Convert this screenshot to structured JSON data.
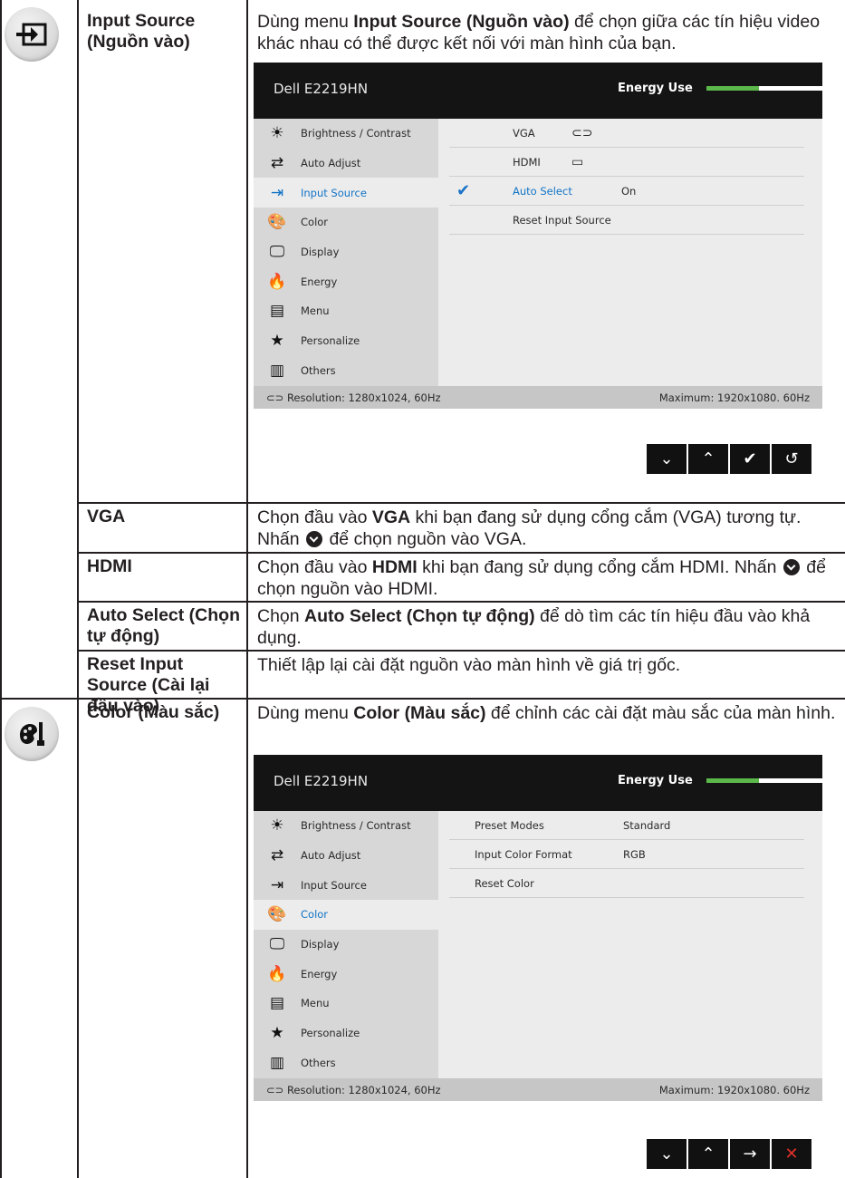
{
  "rows": [
    {
      "term": "Input Source (Nguồn vào)",
      "desc_intro": "Dùng menu ",
      "desc_bold": "Input Source (Nguồn vào)",
      "desc_rest": " để chọn giữa các tín hiệu video khác nhau có thể được kết nối với màn hình của bạn."
    },
    {
      "term": "VGA",
      "desc_intro": "Chọn đầu vào ",
      "desc_bold": "VGA",
      "desc_mid": " khi bạn đang sử dụng cổng cắm (VGA) tương tự. Nhấn ",
      "desc_rest": " để chọn nguồn vào VGA."
    },
    {
      "term": "HDMI",
      "desc_intro": "Chọn đầu vào ",
      "desc_bold": "HDMI",
      "desc_mid": " khi bạn đang sử dụng cổng cắm HDMI. Nhấn ",
      "desc_rest": " để chọn nguồn vào HDMI."
    },
    {
      "term": "Auto Select (Chọn tự động)",
      "desc_intro": "Chọn ",
      "desc_bold": "Auto Select (Chọn tự động)",
      "desc_rest": " để dò tìm các tín hiệu đầu vào khả dụng."
    },
    {
      "term": "Reset Input Source (Cài lại đầu vào)",
      "desc": "Thiết lập lại cài đặt nguồn vào màn hình về giá trị gốc."
    },
    {
      "term": "Color (Màu sắc)",
      "desc_intro": "Dùng menu ",
      "desc_bold": "Color (Màu sắc)",
      "desc_rest": " để chỉnh các cài đặt màu sắc của màn hình."
    }
  ],
  "osd": {
    "model": "Dell E2219HN",
    "energy_label": "Energy Use",
    "energy_level": 0.45,
    "menu": [
      "Brightness / Contrast",
      "Auto Adjust",
      "Input Source",
      "Color",
      "Display",
      "Energy",
      "Menu",
      "Personalize",
      "Others"
    ],
    "resolution": "Resolution: 1280x1024, 60Hz",
    "maximum": "Maximum: 1920x1080. 60Hz"
  },
  "osd1": {
    "items": [
      {
        "label": "VGA",
        "value": ""
      },
      {
        "label": "HDMI",
        "value": ""
      },
      {
        "label": "Auto Select",
        "value": "On"
      },
      {
        "label": "Reset Input Source",
        "value": ""
      }
    ]
  },
  "osd2": {
    "items": [
      {
        "label": "Preset Modes",
        "value": "Standard"
      },
      {
        "label": "Input Color Format",
        "value": "RGB"
      },
      {
        "label": "Reset Color",
        "value": ""
      }
    ]
  },
  "colors": {
    "accent": "#1274c6",
    "energy": "#5db84c",
    "osd_header": "#141414"
  }
}
